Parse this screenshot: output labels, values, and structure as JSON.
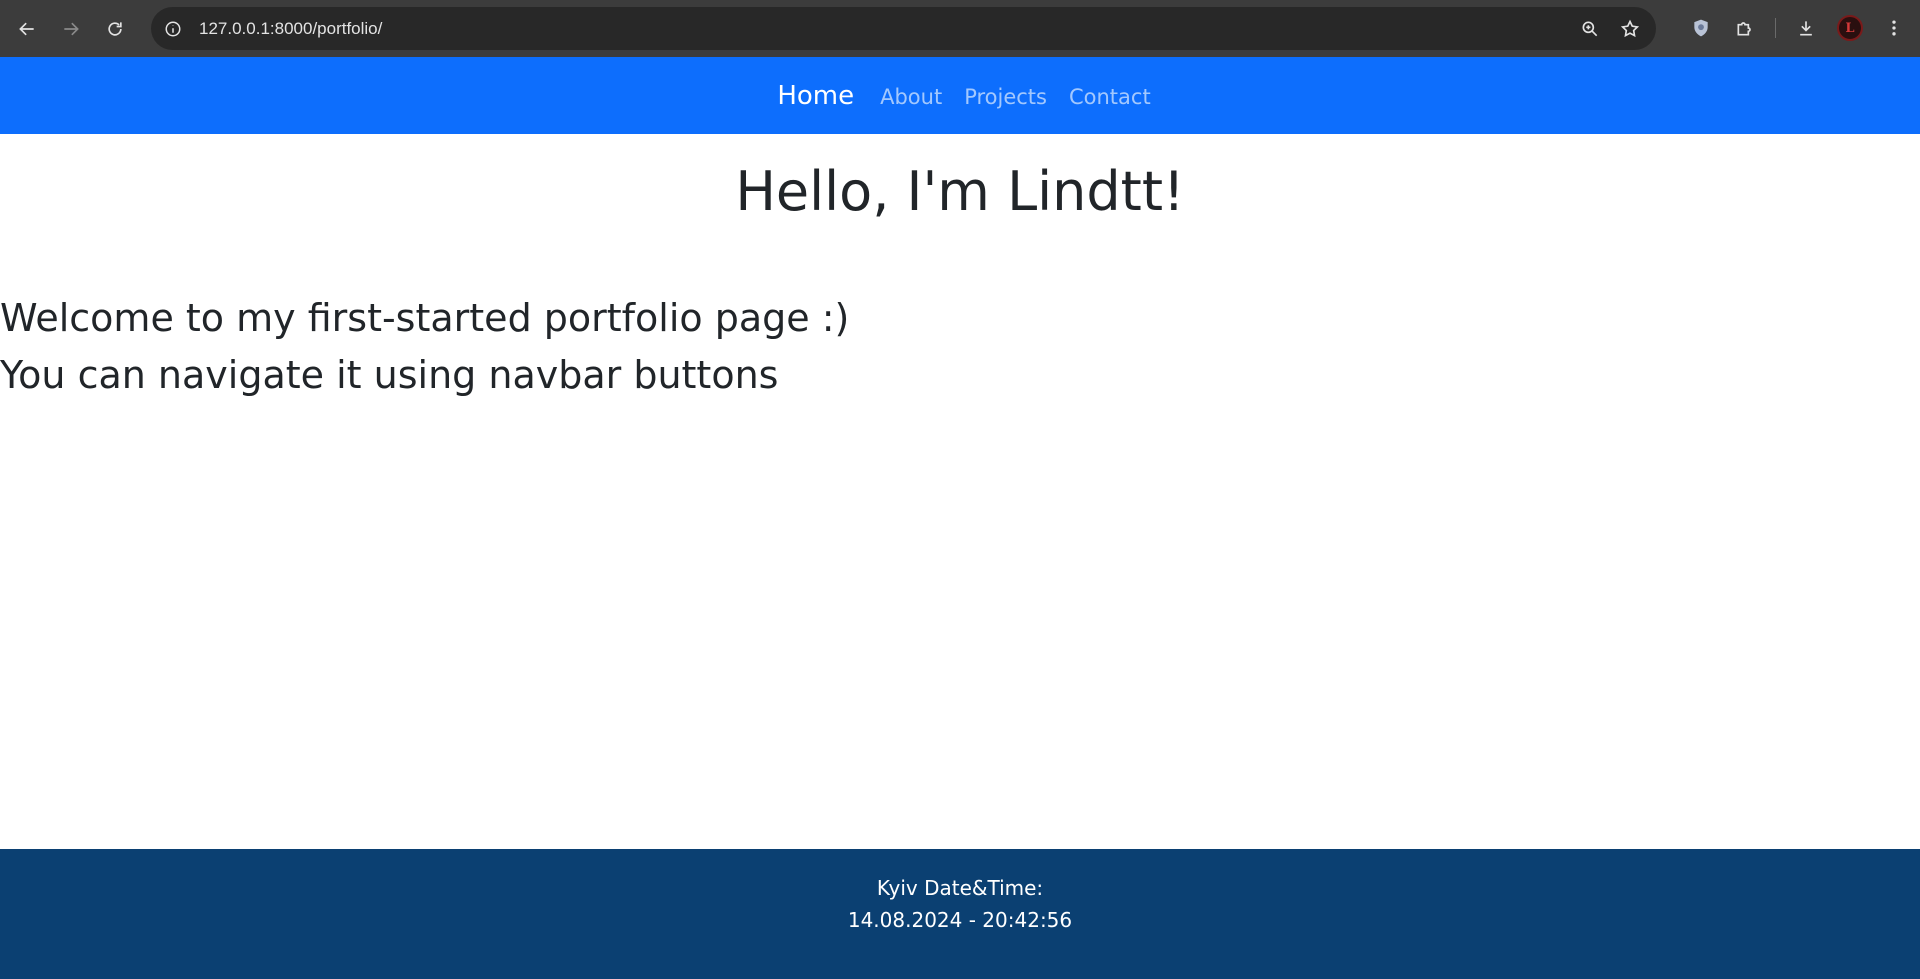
{
  "browser": {
    "url": "127.0.0.1:8000/portfolio/",
    "icons": {
      "back": "arrow-left-icon",
      "forward": "arrow-right-icon",
      "reload": "reload-icon",
      "site_info": "info-circle-icon",
      "zoom": "zoom-icon",
      "bookmark": "star-icon",
      "extension_shield": "shield-icon",
      "extensions": "puzzle-icon",
      "downloads": "download-icon",
      "profile": "avatar",
      "menu": "kebab-menu-icon"
    }
  },
  "navbar": {
    "brand": "Home",
    "links": [
      "About",
      "Projects",
      "Contact"
    ],
    "colors": {
      "background": "#0d6efd"
    }
  },
  "main": {
    "title": "Hello, I'm Lindtt!",
    "lines": [
      "Welcome to my first-started portfolio page :)",
      "You can navigate it using navbar buttons"
    ]
  },
  "footer": {
    "label": "Kyiv Date&Time:",
    "datetime": "14.08.2024 - 20:42:56",
    "colors": {
      "background": "#0b4072"
    }
  }
}
